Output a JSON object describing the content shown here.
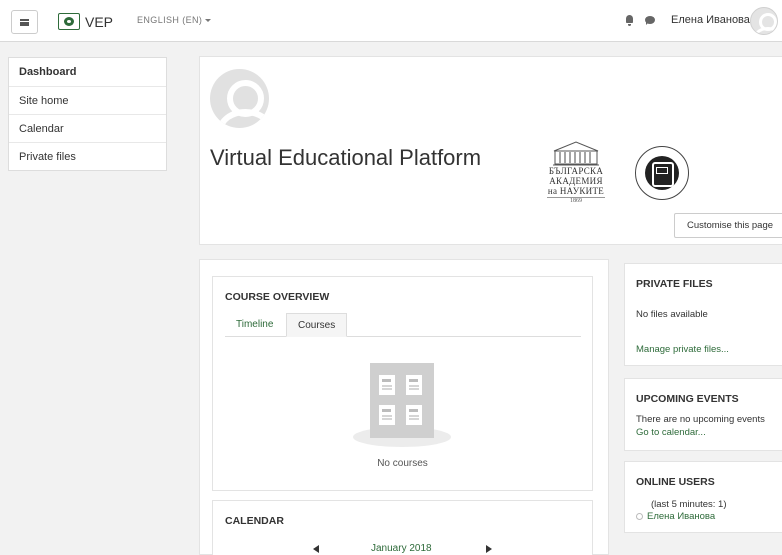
{
  "navbar": {
    "brand": "VEP",
    "language": "ENGLISH (EN)",
    "user_name": "Елена Иванова"
  },
  "drawer": {
    "items": [
      {
        "label": "Dashboard"
      },
      {
        "label": "Site home"
      },
      {
        "label": "Calendar"
      },
      {
        "label": "Private files"
      }
    ]
  },
  "header": {
    "title": "Virtual Educational Platform",
    "bas_logo": {
      "line1": "БЪЛГАРСКА",
      "line2": "АКАДЕМИЯ",
      "line3": "на НАУКИТЕ",
      "year": "1869"
    },
    "customise_label": "Customise this page"
  },
  "course_overview": {
    "title": "COURSE OVERVIEW",
    "tabs": [
      {
        "label": "Timeline"
      },
      {
        "label": "Courses"
      }
    ],
    "active_tab": "Courses",
    "empty_text": "No courses"
  },
  "calendar": {
    "title": "CALENDAR",
    "month": "January 2018"
  },
  "private_files": {
    "title": "PRIVATE FILES",
    "empty_text": "No files available",
    "manage_link": "Manage private files..."
  },
  "upcoming_events": {
    "title": "UPCOMING EVENTS",
    "empty_text": "There are no upcoming events",
    "calendar_link": "Go to calendar..."
  },
  "online_users": {
    "title": "ONLINE USERS",
    "summary": "(last 5 minutes: 1)",
    "users": [
      {
        "name": "Елена Иванова"
      }
    ]
  },
  "colors": {
    "link": "#2e6b3a",
    "page_bg": "#f2f2f2",
    "card_bg": "#ffffff"
  }
}
